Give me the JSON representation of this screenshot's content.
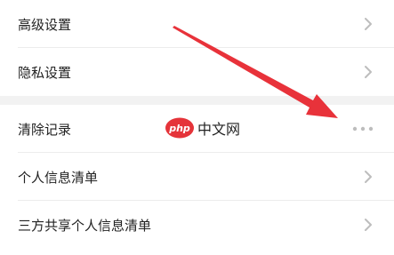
{
  "settings_top": {
    "items": [
      {
        "label": "高级设置"
      },
      {
        "label": "隐私设置"
      }
    ]
  },
  "settings_bottom": {
    "items": [
      {
        "label": "清除记录"
      },
      {
        "label": "个人信息清单"
      },
      {
        "label": "三方共享个人信息清单"
      }
    ]
  },
  "watermark": {
    "logo_text": "php",
    "site_text": "中文网"
  },
  "icons": {
    "chevron": "chevron-right-icon",
    "more": "more-horizontal-icon"
  },
  "colors": {
    "arrow": "#e8323a",
    "watermark_logo": "#e5343a",
    "chevron": "#bdbdbd"
  }
}
